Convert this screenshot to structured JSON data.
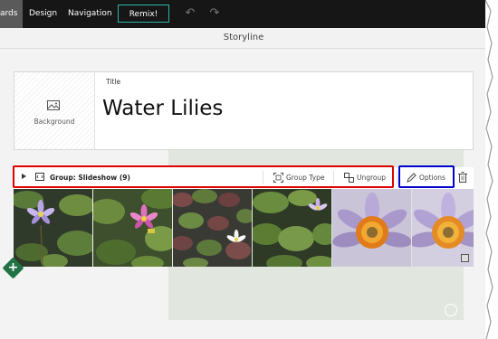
{
  "topbar": {
    "tabs": [
      {
        "label": "ards",
        "active": true
      },
      {
        "label": "Design",
        "active": false
      },
      {
        "label": "Navigation",
        "active": false
      }
    ],
    "remix_label": "Remix!",
    "undo_icon": "undo-icon",
    "redo_icon": "redo-icon"
  },
  "subheader": {
    "title": "Storyline"
  },
  "title_card": {
    "background_label": "Background",
    "background_icon": "image-icon",
    "title_label": "Title",
    "title_text": "Water Lilies"
  },
  "group_bar": {
    "label": "Group: Slideshow (9)",
    "group_type_label": "Group Type",
    "ungroup_label": "Ungroup",
    "options_label": "Options",
    "icons": [
      "expand-caret-icon",
      "group-icon",
      "group-type-icon",
      "ungroup-icon",
      "pencil-icon",
      "trash-icon"
    ]
  },
  "photos": [
    {
      "name": "purple-lily-photo"
    },
    {
      "name": "pink-lily-photo"
    },
    {
      "name": "white-lily-pads-photo"
    },
    {
      "name": "lily-pads-photo"
    },
    {
      "name": "orange-center-lily-photo"
    },
    {
      "name": "orange-center-lily-partial-photo"
    }
  ],
  "colors": {
    "topbar_bg": "#161616",
    "remix_border": "#2db4a6",
    "highlight_red": "#e00000",
    "highlight_blue": "#0000cc",
    "add_button": "#217346"
  }
}
